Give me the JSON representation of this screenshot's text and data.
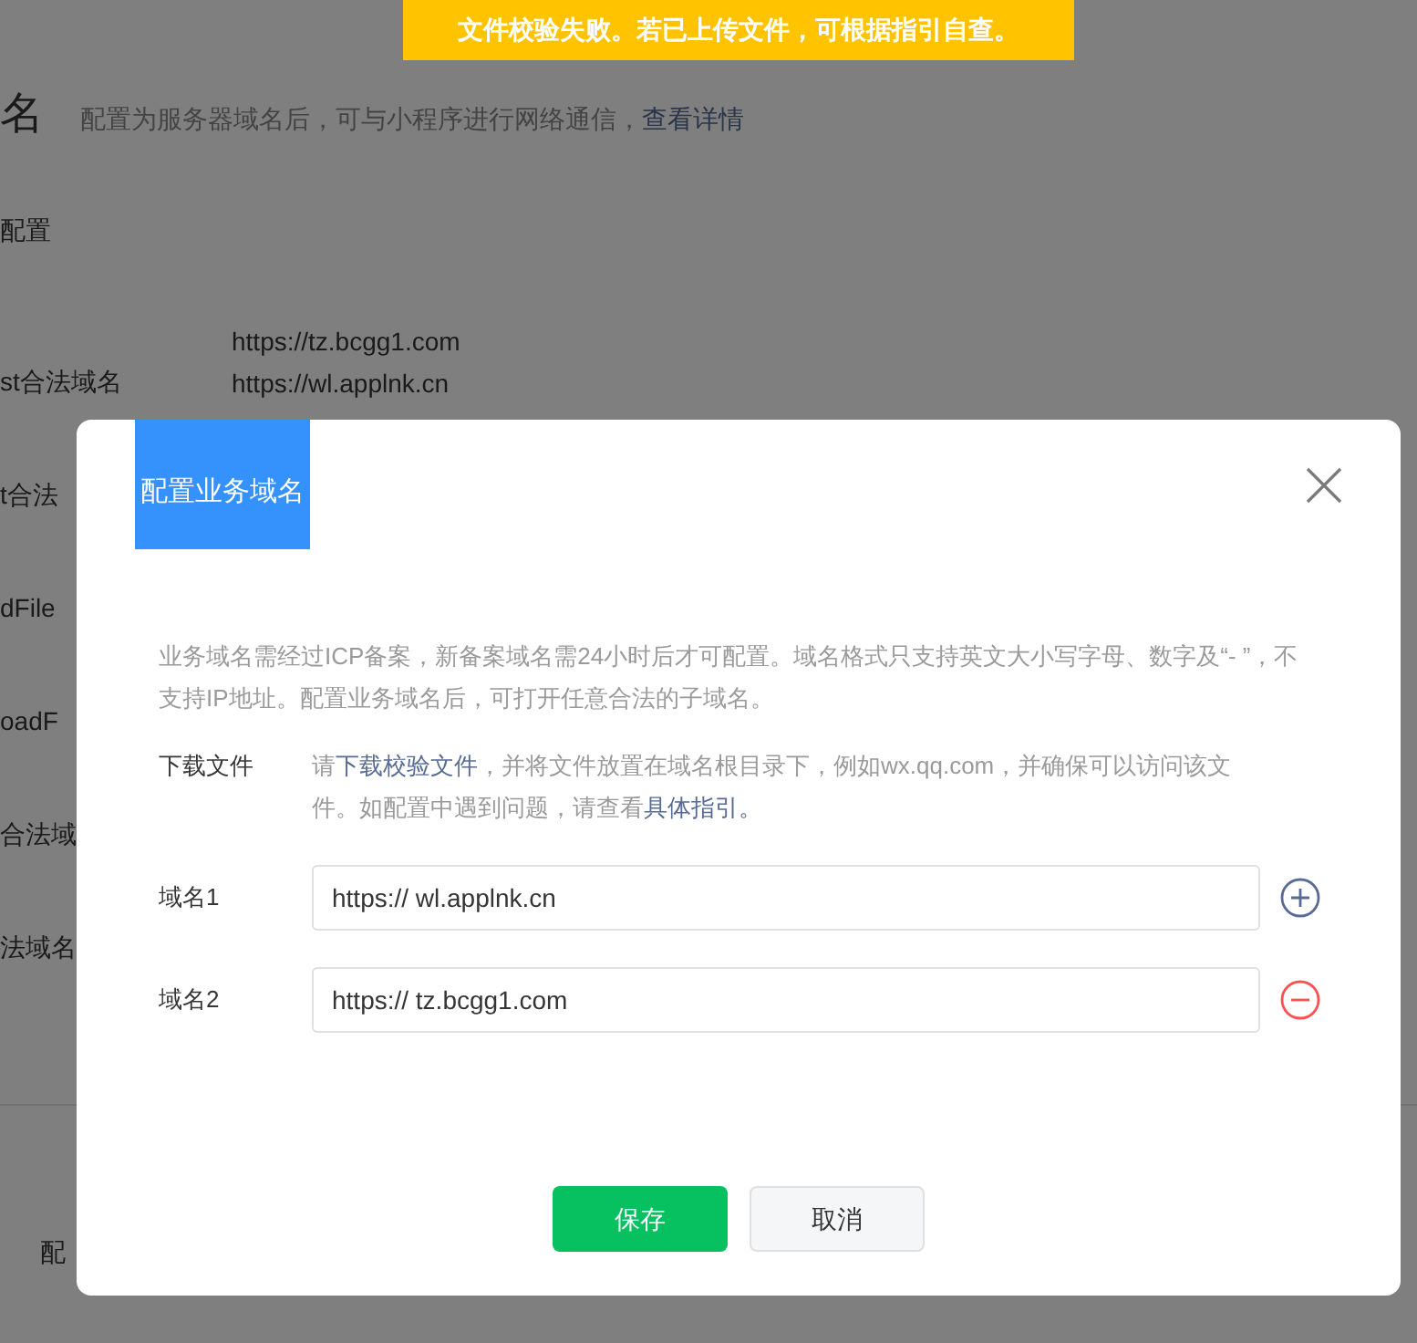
{
  "toast": {
    "text": "文件校验失败。若已上传文件，可根据指引自查。"
  },
  "background": {
    "heading": "名",
    "subtitle": "配置为服务器域名后，可与小程序进行网络通信，",
    "subtitle_link": "查看详情",
    "section": "配置",
    "request_domains": [
      "https://tz.bcgg1.com",
      "https://wl.applnk.cn"
    ],
    "labels": [
      "st合法域名",
      "t合法",
      "dFile",
      "oadF",
      "合法域",
      "法域名"
    ],
    "footer_label": "配"
  },
  "dialog": {
    "title": "配置业务域名",
    "notice": "业务域名需经过ICP备案，新备案域名需24小时后才可配置。域名格式只支持英文大小写字母、数字及“- ”，不支持IP地址。配置业务域名后，可打开任意合法的子域名。",
    "download": {
      "label": "下载文件",
      "text": "请**下载校验文件**，并将文件放置在域名根目录下，例如wx.qq.com，并确保可以访问该文件。如配置中遇到问题，请查看**具体指引。**"
    },
    "domains": [
      {
        "label": "域名1",
        "value": "https:// wl.applnk.cn",
        "kind": "add"
      },
      {
        "label": "域名2",
        "value": "https:// tz.bcgg1.com",
        "kind": "remove"
      }
    ],
    "buttons": [
      {
        "label": "保存",
        "kind": "primary"
      },
      {
        "label": "取消",
        "kind": "default"
      }
    ]
  }
}
